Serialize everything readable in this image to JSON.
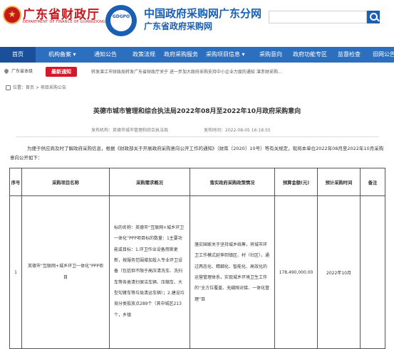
{
  "header": {
    "dept_name": "广东省财政厅",
    "dept_en": "DEPARTMENT OF FINANCE OF GUANGDONG PROVINCE",
    "logo_text": "GDGPO",
    "site_title": "中国政府采购网广东分网",
    "site_subtitle": "广东省政府采购网"
  },
  "nav": {
    "items": [
      {
        "label": "首页"
      },
      {
        "label": "机构备案 ▾"
      },
      {
        "label": "通知公告"
      },
      {
        "label": "政策法规"
      },
      {
        "label": "政府采购服务"
      },
      {
        "label": "采购项目信息 ▾"
      },
      {
        "label": "采购意向"
      },
      {
        "label": "政府功能专区"
      },
      {
        "label": "监督检查"
      },
      {
        "label": "旧网公告"
      }
    ]
  },
  "info_bar": {
    "region": "广东省本级",
    "latest_label": "最新通知",
    "marquee": "转发湛江市财政局转发广东省财政厅关于 进一步加大政府采购支持中小企业力度的通知 湛赤财采购..."
  },
  "breadcrumb": "位置：首页 > 项目采购公告",
  "article": {
    "title": "英德市城市管理和综合执法局2022年08月至2022年10月政府采购意向",
    "publisher": "发布机构：英德市城市管理和综合执法局",
    "publish_time": "发布时间：2022-08-05 16:18:55",
    "intro": "为便于供应商及时了解政府采购信息，根据《财政部关于开展政府采购意向公开工作的通知》（财库〔2020〕10号）等有关规定，现将本单位2022年08月至2022年10月采购意向公开如下："
  },
  "table": {
    "headers": [
      "序号",
      "采购项目名称",
      "采购需求概况",
      "落实政府采购政策情况",
      "预算金额(元)",
      "预计采购时间",
      "备注"
    ],
    "rows": [
      {
        "index": "1",
        "name": "英德市“互联网+城乡环卫一体化”PPP项目",
        "demand": "标的名称：英德市“互联网+城乡环卫一体化”PPP项目标的数量：1主要功能或目标：1.环卫作业设备用斯更新，按服务范围增加投入专业环卫设备（包括但不限于高压清洗车、洗扫车等各类清扫保洁车辆、压缩车、大型勾臂车等垃圾清运车辆）；2.建设垃圾分类投放点289个（其中城区213个，乡镇",
        "policy": "落实国家关于坚持城乡统筹，将城市环卫工作模式延伸到镇区、村（社区），通过两态化、精细化、智能化、高效化的运营管理体系，实现城乡环境卫生工作的“全方位覆盖、无缝隙对接、一体化管理”目",
        "budget": "178,490,000.00",
        "time": "2022年10月",
        "remark": ""
      }
    ]
  }
}
